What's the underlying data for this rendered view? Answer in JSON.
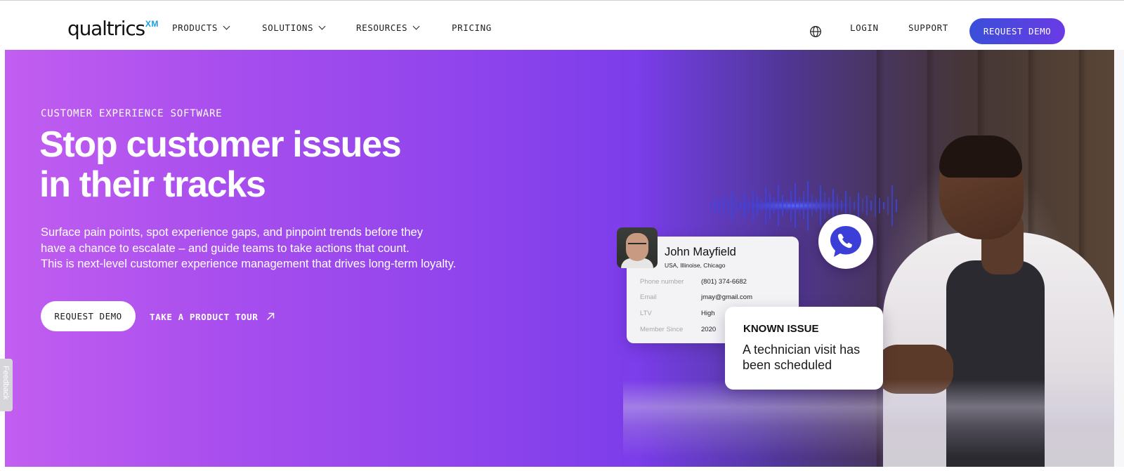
{
  "nav": {
    "logo_text": "qualtrics",
    "logo_suffix": "XM",
    "items": [
      {
        "label": "PRODUCTS"
      },
      {
        "label": "SOLUTIONS"
      },
      {
        "label": "RESOURCES"
      },
      {
        "label": "PRICING"
      }
    ],
    "login": "LOGIN",
    "support": "SUPPORT",
    "cta": "REQUEST DEMO"
  },
  "hero": {
    "eyebrow": "CUSTOMER EXPERIENCE SOFTWARE",
    "headline_line1": "Stop customer issues",
    "headline_line2": "in their tracks",
    "sub_line1": "Surface pain points, spot experience gaps, and pinpoint trends before they",
    "sub_line2": "have a chance to escalate – and guide teams to take actions that count.",
    "sub_line3": "This is next-level customer experience management that drives long-term loyalty.",
    "primary_button": "REQUEST DEMO",
    "secondary_button": "TAKE A PRODUCT TOUR"
  },
  "card": {
    "name": "John Mayfield",
    "location": "USA, Illinoise, Chicago",
    "rows": [
      {
        "key": "Phone number",
        "value": "(801) 374-6682"
      },
      {
        "key": "Email",
        "value": "jmay@gmail.com"
      },
      {
        "key": "LTV",
        "value": "High"
      },
      {
        "key": "Member Since",
        "value": "2020"
      }
    ]
  },
  "issue": {
    "title": "KNOWN ISSUE",
    "body": "A technician visit has been scheduled"
  },
  "feedback_tab": "Feedback",
  "colors": {
    "accent": "#4b48e0",
    "hero_start": "#c25ef0",
    "hero_mid": "#7a3dea"
  },
  "icons": {
    "globe": "globe-icon",
    "chevron": "chevron-down-icon",
    "arrow": "arrow-up-right-icon",
    "phone": "phone-call-icon"
  }
}
